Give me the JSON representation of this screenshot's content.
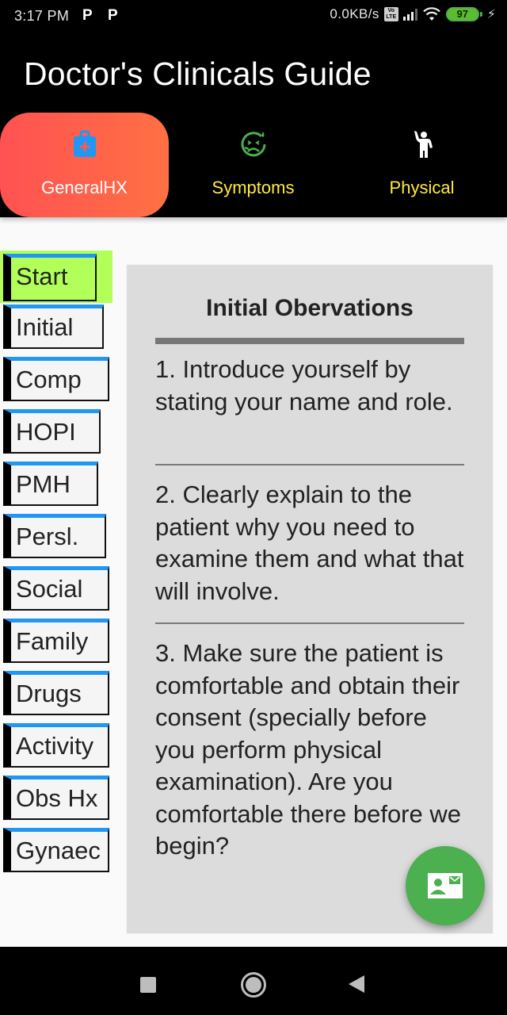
{
  "status_bar": {
    "time": "3:17 PM",
    "notification_icons": [
      "P",
      "P"
    ],
    "net_speed": "0.0KB/s",
    "volte": "Vo LTE",
    "battery": "97"
  },
  "app_bar": {
    "title": "Doctor's Clinicals Guide"
  },
  "tabs": [
    {
      "label": "GeneralHX",
      "icon": "medical-bag-icon",
      "active": true
    },
    {
      "label": "Symptoms",
      "icon": "sick-face-icon",
      "active": false
    },
    {
      "label": "Physical",
      "icon": "person-raising-hand-icon",
      "active": false
    }
  ],
  "side_nav": {
    "selected": "Start",
    "items": [
      {
        "label": "Start"
      },
      {
        "label": "Initial"
      },
      {
        "label": "Comp"
      },
      {
        "label": "HOPI"
      },
      {
        "label": "PMH"
      },
      {
        "label": "Persl."
      },
      {
        "label": "Social"
      },
      {
        "label": "Family"
      },
      {
        "label": "Drugs"
      },
      {
        "label": "Activity"
      },
      {
        "label": "Obs Hx"
      },
      {
        "label": "Gynaec"
      }
    ]
  },
  "card": {
    "title": "Initial Obervations",
    "items": [
      "1. Introduce yourself by stating your name and role.",
      "2. Clearly explain to the patient why you need to examine them and what that will involve.",
      "3. Make sure the patient is comfortable and obtain their consent (specially before you perform physical examination). Are you comfortable there before we begin?"
    ]
  },
  "fab": {
    "icon": "contact-mail-icon"
  },
  "colors": {
    "active_tab_gradient_start": "#ff5252",
    "active_tab_gradient_end": "#ff7043",
    "inactive_tab_label": "#ffeb3b",
    "selected_nav_bg": "#b2ff59",
    "nav_top_border": "#2196f3",
    "fab": "#4caf50",
    "card_bg": "#dcdcdc"
  }
}
